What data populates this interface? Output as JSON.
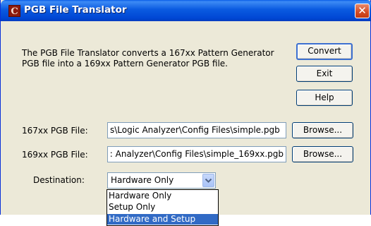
{
  "window": {
    "title": "PGB File Translator",
    "icon": "app-logo-icon",
    "close_symbol": "✕"
  },
  "description": "The PGB File Translator converts a 167xx Pattern Generator PGB file into a 169xx Pattern Generator PGB file.",
  "buttons": {
    "convert": "Convert",
    "exit": "Exit",
    "help": "Help",
    "browse_167": "Browse...",
    "browse_169": "Browse..."
  },
  "fields": {
    "file167_label": "167xx PGB File:",
    "file167_value": "s\\Logic Analyzer\\Config Files\\simple.pgb",
    "file169_label": "169xx PGB File:",
    "file169_value": ": Analyzer\\Config Files\\simple_169xx.pgb"
  },
  "destination": {
    "label": "Destination:",
    "selected": "Hardware Only",
    "options": [
      "Hardware Only",
      "Setup Only",
      "Hardware and Setup"
    ],
    "highlighted_index": 2
  },
  "colors": {
    "titlebar": "#0a5ae0",
    "dialog_bg": "#ece9d8",
    "highlight": "#316ac5"
  }
}
